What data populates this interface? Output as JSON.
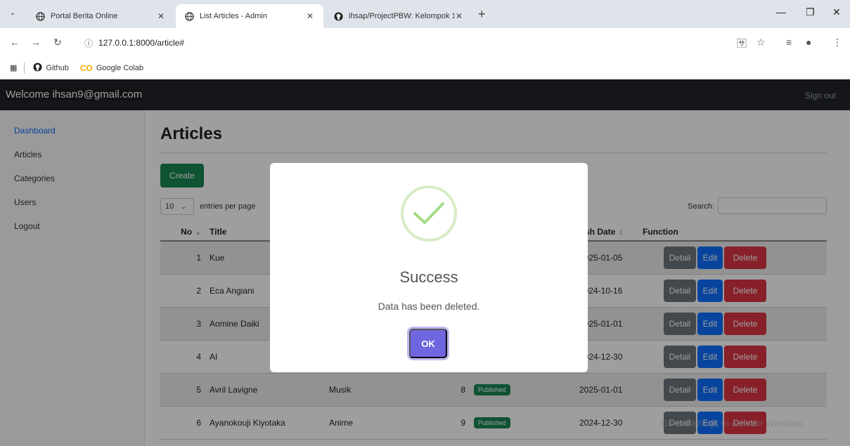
{
  "browser": {
    "tabs": [
      {
        "title": "Portal Berita Online",
        "icon": "globe-icon",
        "active": false
      },
      {
        "title": "List Articles - Admin",
        "icon": "globe-icon",
        "active": true
      },
      {
        "title": "ihsap/ProjectPBW: Kelompok 1",
        "icon": "github-icon",
        "active": false
      }
    ],
    "url": "127.0.0.1:8000/article#",
    "bookmarks": [
      {
        "label": "Github",
        "icon": "github-icon"
      },
      {
        "label": "Google Colab",
        "icon": "colab-icon"
      }
    ]
  },
  "navbar": {
    "brand": "Welcome ihsan9@gmail.com",
    "signout": "Sign out"
  },
  "sidebar": {
    "items": [
      {
        "label": "Dashboard",
        "active": true
      },
      {
        "label": "Articles",
        "active": false
      },
      {
        "label": "Categories",
        "active": false
      },
      {
        "label": "Users",
        "active": false
      },
      {
        "label": "Logout",
        "active": false
      }
    ]
  },
  "main": {
    "title": "Articles",
    "create_label": "Create",
    "entries_value": "10",
    "entries_label": "entries per page",
    "search_label": "Search:",
    "columns": {
      "no": "No",
      "title": "Title",
      "publish_date": "blish Date",
      "function": "Function"
    },
    "rows": [
      {
        "no": "1",
        "title": "Kue",
        "category": "",
        "views": "",
        "status": "",
        "date": "2025-01-05"
      },
      {
        "no": "2",
        "title": "Eca Angiani",
        "category": "",
        "views": "",
        "status": "",
        "date": "2024-10-16"
      },
      {
        "no": "3",
        "title": "Aomine Daiki",
        "category": "",
        "views": "",
        "status": "",
        "date": "2025-01-01"
      },
      {
        "no": "4",
        "title": "AI",
        "category": "",
        "views": "",
        "status": "",
        "date": "2024-12-30"
      },
      {
        "no": "5",
        "title": "Avril Lavigne",
        "category": "Musik",
        "views": "8",
        "status": "Published",
        "date": "2025-01-01"
      },
      {
        "no": "6",
        "title": "Ayanokouji Kiyotaka",
        "category": "Anime",
        "views": "9",
        "status": "Published",
        "date": "2024-12-30"
      }
    ],
    "btn_detail": "Detail",
    "btn_edit": "Edit",
    "btn_delete": "Delete"
  },
  "watermark": "Go to Settings to activate Windows.",
  "modal": {
    "title": "Success",
    "text": "Data has been deleted.",
    "ok_label": "OK",
    "icon": "success-check-icon",
    "accent": "#7066e0",
    "check_color": "#a5dc86"
  }
}
